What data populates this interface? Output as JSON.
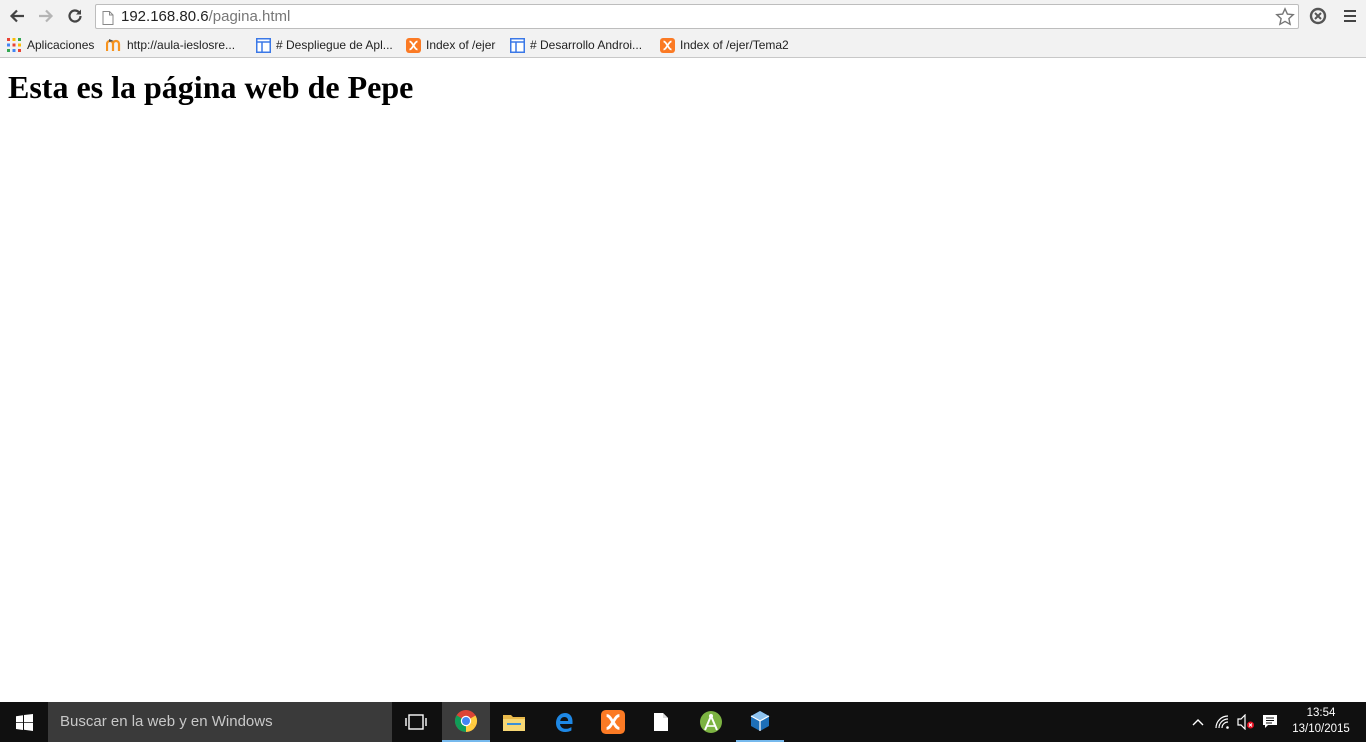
{
  "browser": {
    "url_host": "192.168.80.6",
    "url_path": "/pagina.html",
    "bookmarks": [
      {
        "label": "Aplicaciones",
        "icon": "apps-grid-icon"
      },
      {
        "label": "http://aula-ieslosre...",
        "icon": "moodle-icon"
      },
      {
        "label": "# Despliegue de Apl...",
        "icon": "page-layout-icon"
      },
      {
        "label": "Index of /ejer",
        "icon": "xampp-icon"
      },
      {
        "label": "# Desarrollo Androi...",
        "icon": "page-layout-icon"
      },
      {
        "label": "Index of /ejer/Tema2",
        "icon": "xampp-icon"
      }
    ]
  },
  "page": {
    "heading": "Esta es la página web de Pepe"
  },
  "taskbar": {
    "search_placeholder": "Buscar en la web y en Windows",
    "apps": [
      "task-view-icon",
      "chrome-icon",
      "file-explorer-icon",
      "edge-icon",
      "xampp-icon",
      "file-icon",
      "android-studio-icon",
      "virtualbox-icon"
    ],
    "clock_time": "13:54",
    "clock_date": "13/10/2015"
  },
  "colors": {
    "toolbar_bg": "#f2f2f2",
    "taskbar_bg": "#101010",
    "taskbar_accent": "#76b9ed"
  }
}
